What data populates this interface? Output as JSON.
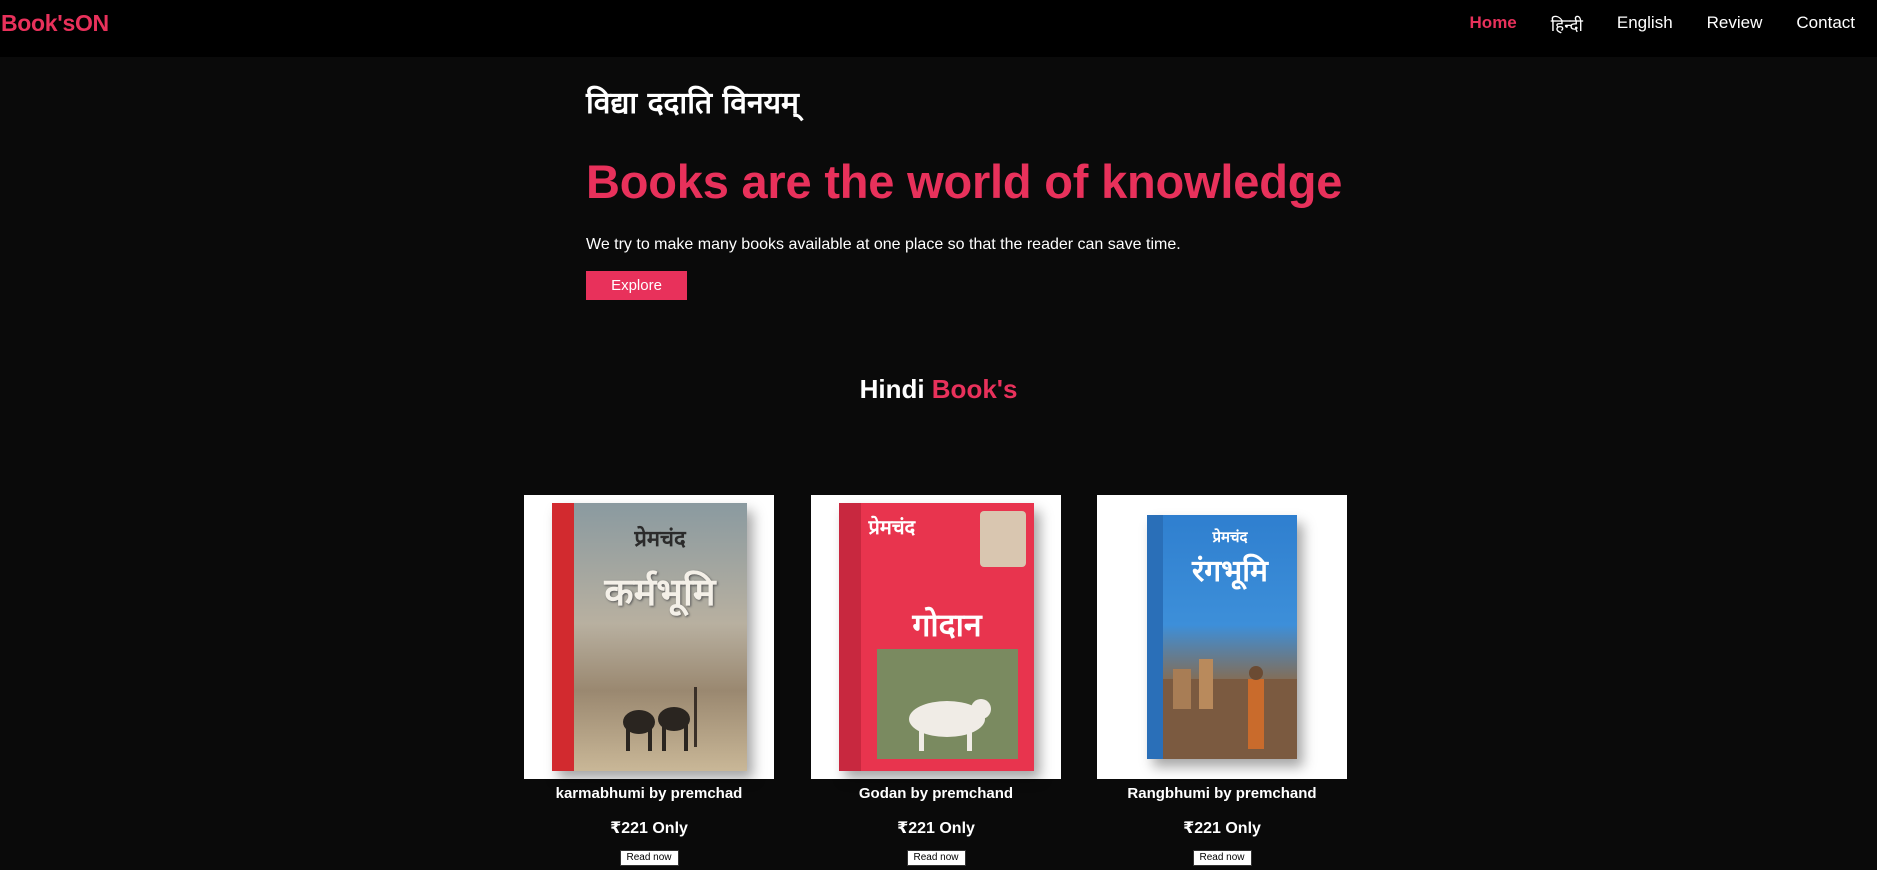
{
  "brand": "Book'sON",
  "nav": [
    {
      "label": "Home",
      "active": true
    },
    {
      "label": "हिन्दी",
      "active": false
    },
    {
      "label": "English",
      "active": false
    },
    {
      "label": "Review",
      "active": false
    },
    {
      "label": "Contact",
      "active": false
    }
  ],
  "hero": {
    "motto": "विद्या ददाति विनयम्",
    "headline": "Books are the world of knowledge",
    "tagline": "We try to make many books available at one place so that the reader can save time.",
    "cta_label": "Explore"
  },
  "section": {
    "title_plain": "Hindi ",
    "title_accent": "Book's"
  },
  "books": [
    {
      "title": "karmabhumi by premchad",
      "price": "₹221 Only",
      "action": "Read now",
      "cover_author": "प्रेमचंद",
      "cover_title": "कर्मभूमि"
    },
    {
      "title": "Godan by premchand",
      "price": "₹221 Only",
      "action": "Read now",
      "cover_author": "प्रेमचंद",
      "cover_title": "गोदान"
    },
    {
      "title": "Rangbhumi by premchand",
      "price": "₹221 Only",
      "action": "Read now",
      "cover_author": "प्रेमचंद",
      "cover_title": "रंगभूमि"
    }
  ],
  "colors": {
    "accent": "#e8315b",
    "background": "#0a0a0a",
    "navbar": "#000000"
  }
}
